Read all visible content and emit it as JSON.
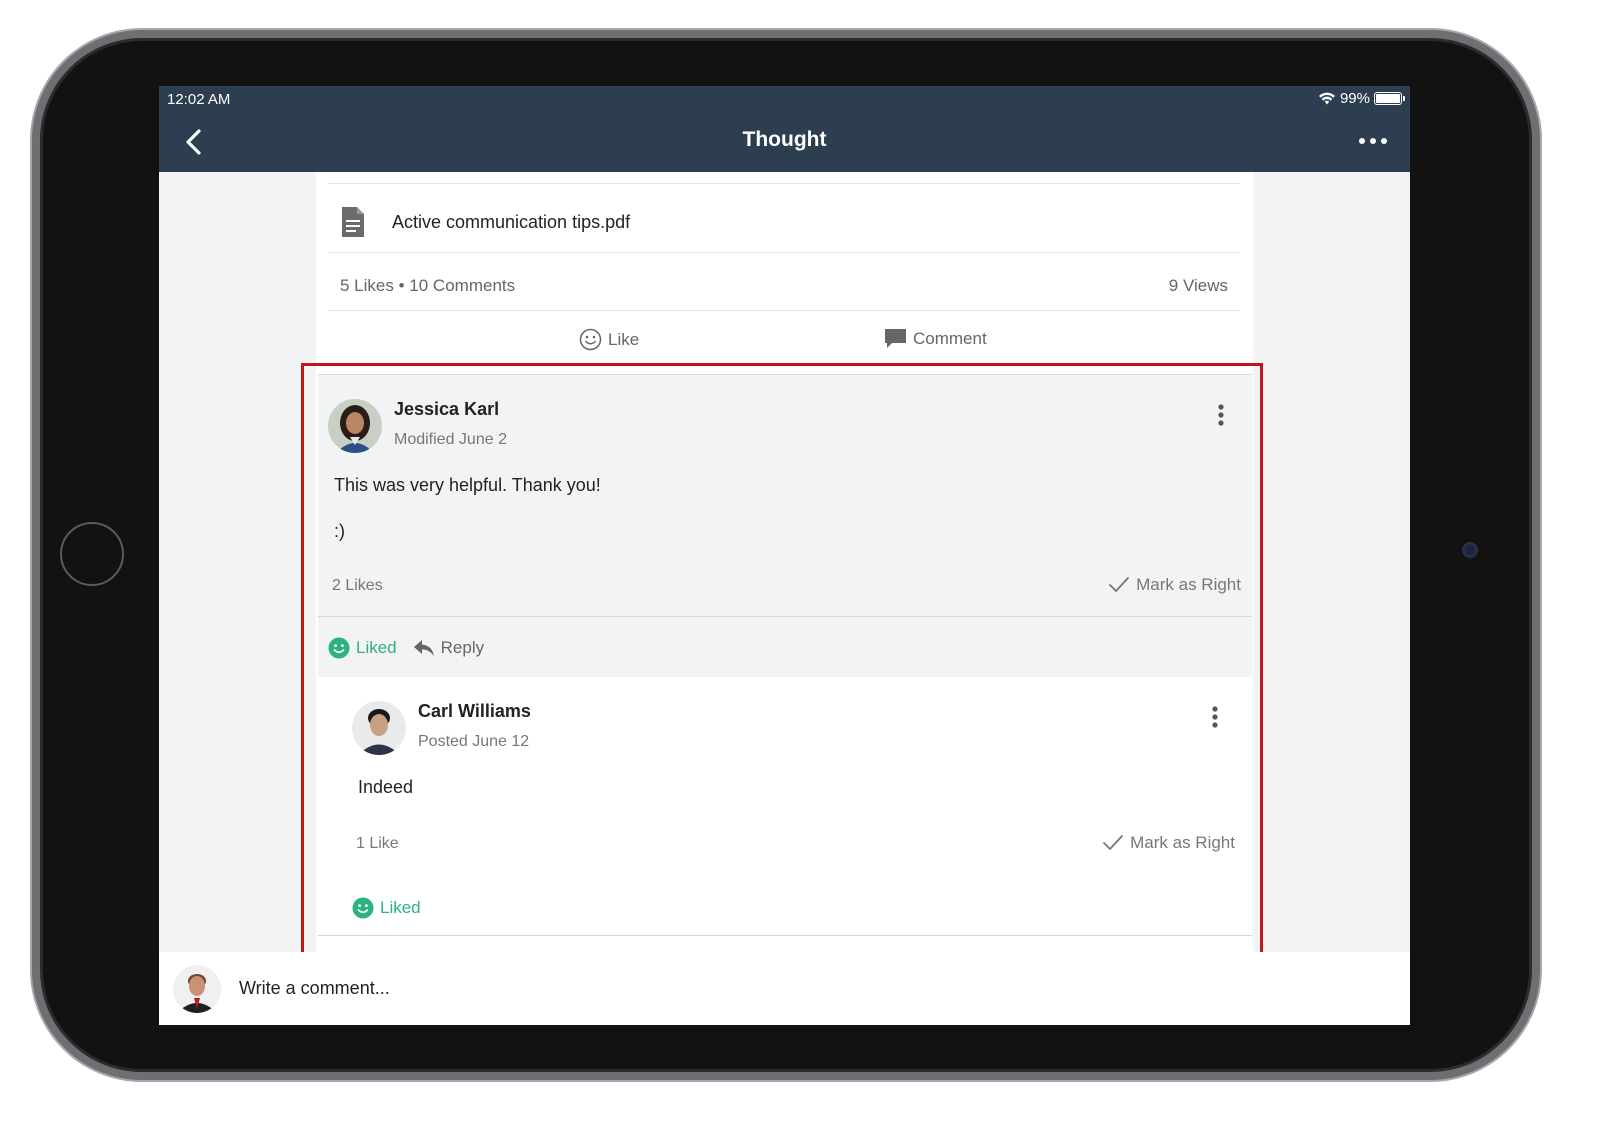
{
  "status_bar": {
    "time": "12:02 AM",
    "battery": "99%"
  },
  "nav": {
    "title": "Thought"
  },
  "post": {
    "attachment": "Active communication tips.pdf",
    "likes": "5 Likes",
    "separator": "•",
    "comments": "10 Comments",
    "views": "9 Views",
    "actions": {
      "like": "Like",
      "comment": "Comment"
    }
  },
  "comment": {
    "author": "Jessica Karl",
    "meta": "Modified June 2",
    "text_line1": "This was very helpful. Thank you!",
    "text_line2": ":)",
    "likes": "2 Likes",
    "mark_right": "Mark as Right",
    "liked": "Liked",
    "reply": "Reply"
  },
  "reply": {
    "author": "Carl Williams",
    "meta": "Posted June 12",
    "text": "Indeed",
    "likes": "1 Like",
    "mark_right": "Mark as Right",
    "liked": "Liked"
  },
  "composer": {
    "placeholder": "Write a comment..."
  },
  "colors": {
    "header": "#2c3e50",
    "liked": "#2db37d",
    "highlight": "#c0171e"
  }
}
